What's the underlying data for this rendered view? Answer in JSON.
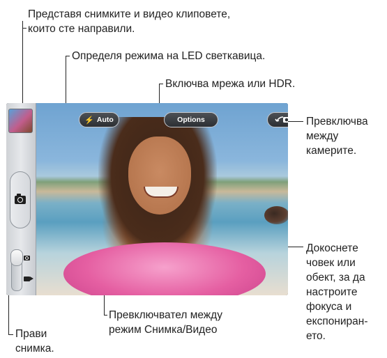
{
  "callouts": {
    "viewer": "Представя снимките и видео клиповете,\nкоито сте направили.",
    "flash": "Определя режима на LED светкавица.",
    "options": "Включва мрежа или HDR.",
    "switch_camera": "Превключва\nмежду\nкамерите.",
    "focus": "Докоснете\nчовек или\nобект, за да\nнастроите\nфокуса и\nекспониран-\nето.",
    "mode_switch": "Превключвател между\nрежим Снимка/Видео",
    "take_photo": "Прави\nснимка."
  },
  "camera": {
    "flash_label": "Auto",
    "options_label": "Options",
    "flash_icon": "lightning-bolt-icon",
    "flip_icon": "camera-flip-icon",
    "shutter_icon": "camera-icon"
  }
}
